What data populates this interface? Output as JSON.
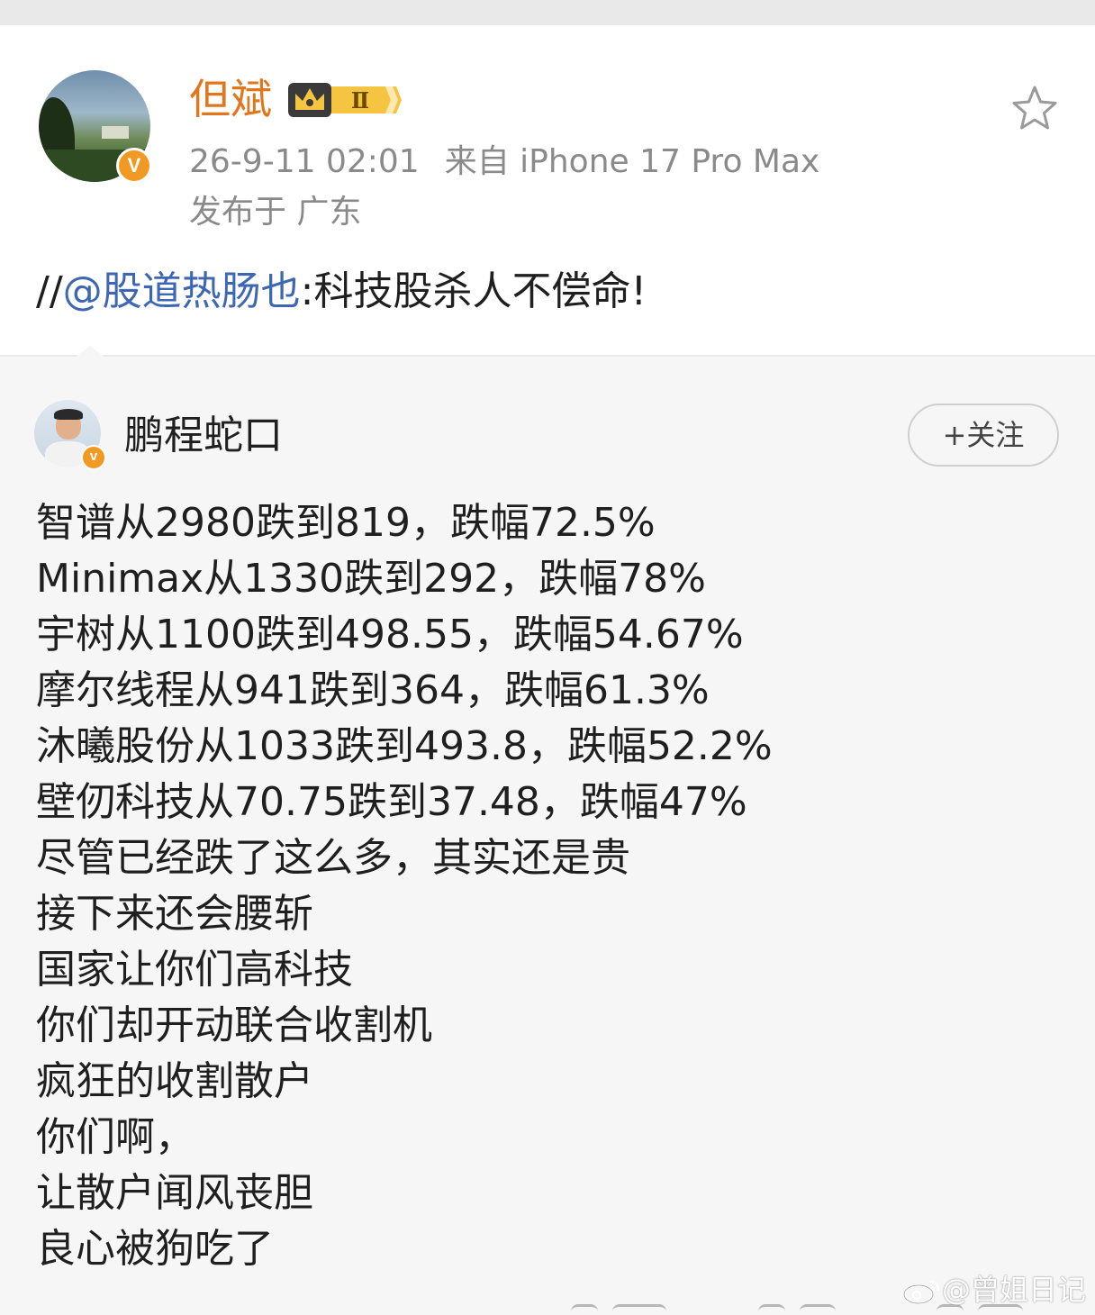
{
  "post": {
    "username": "但斌",
    "level_badge": "Ⅱ",
    "timestamp": "26-9-11 02:01",
    "source": "来自 iPhone 17 Pro Max",
    "location": "发布于 广东",
    "repost_prefix": "//",
    "repost_mention": "@股道热肠也",
    "repost_text": ":科技股杀人不偿命!",
    "verified_mark": "V"
  },
  "original": {
    "username": "鹏程蛇口",
    "follow_label": "+关注",
    "verified_mark": "v",
    "lines": [
      "智谱从2980跌到819，跌幅72.5%",
      "Minimax从1330跌到292，跌幅78%",
      "宇树从1100跌到498.55，跌幅54.67%",
      "摩尔线程从941跌到364，跌幅61.3%",
      "沐曦股份从1033跌到493.8，跌幅52.2%",
      "壁仞科技从70.75跌到37.48，跌幅47%",
      "尽管已经跌了这么多，其实还是贵",
      "接下来还会腰斩",
      "国家让你们高科技",
      "你们却开动联合收割机",
      "疯狂的收割散户",
      "你们啊，",
      "让散户闻风丧胆",
      "良心被狗吃了"
    ]
  },
  "watermark": {
    "text": "@曾姐日记"
  },
  "icons": {
    "favorite": "star-icon",
    "crown": "crown-icon",
    "weibo": "weibo-icon"
  },
  "colors": {
    "username": "#e2761d",
    "mention": "#3d66b5",
    "meta": "#8a8a8a",
    "verified": "#f19a23"
  }
}
